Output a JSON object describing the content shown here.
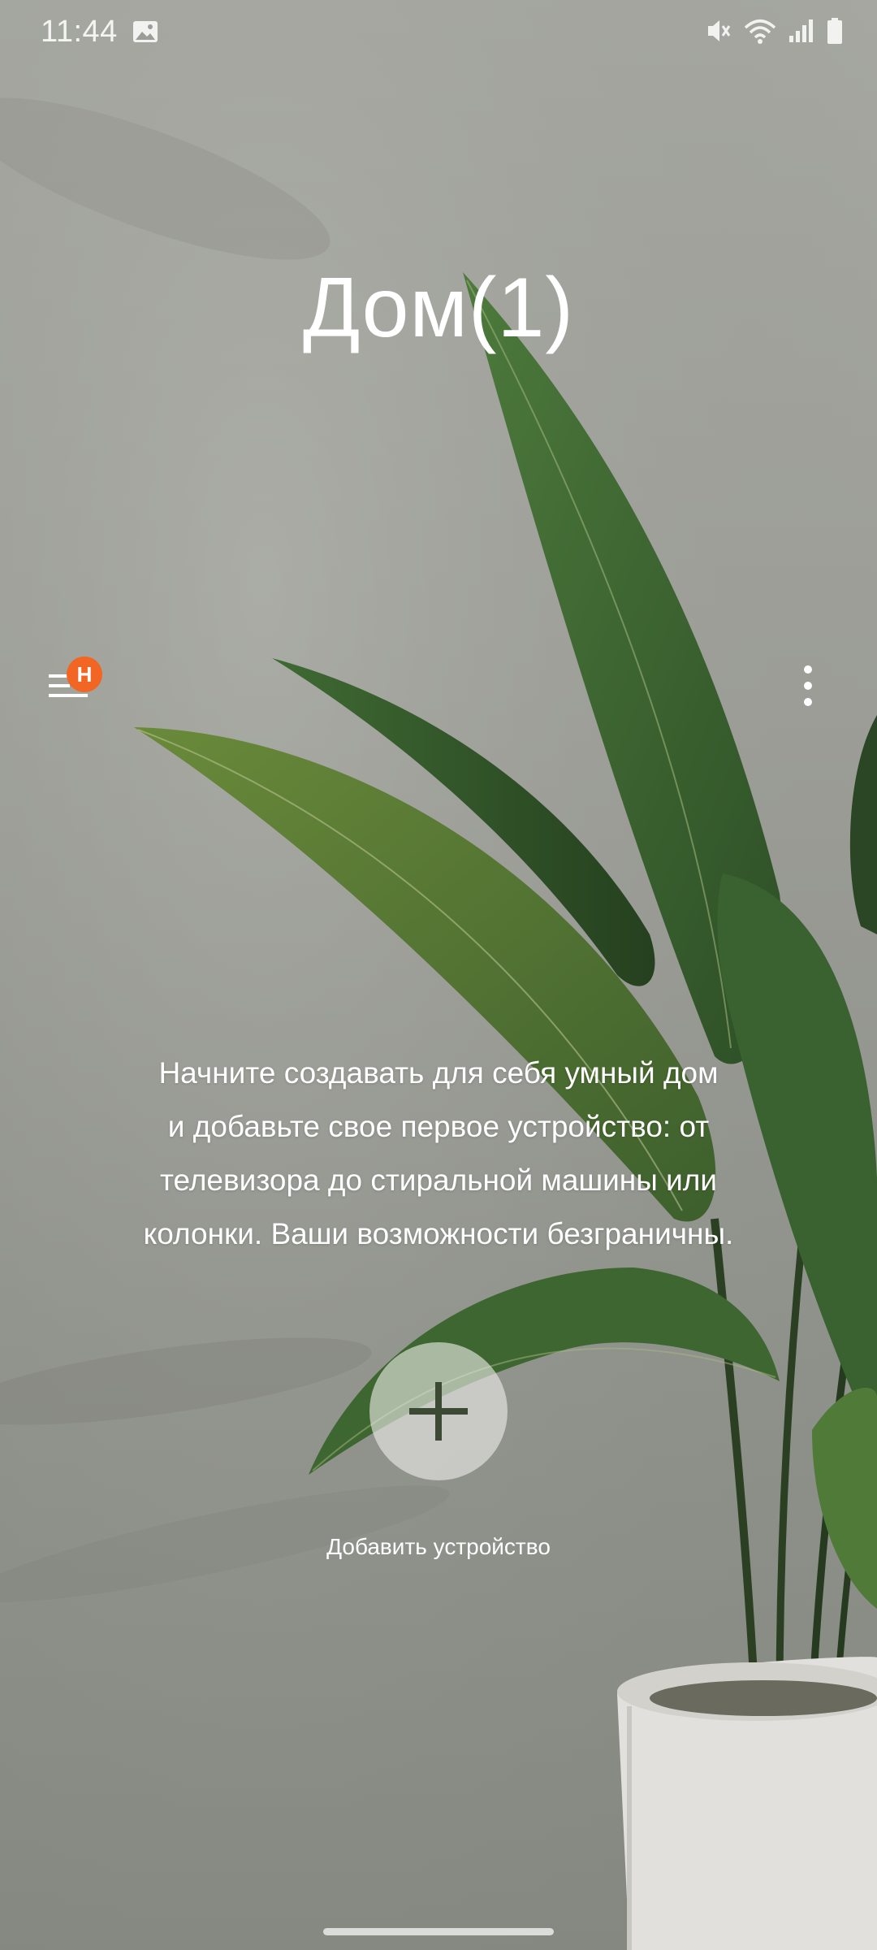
{
  "status_bar": {
    "time": "11:44",
    "icons": [
      "gallery-icon",
      "mute-vibrate-icon",
      "wifi-icon",
      "cellular-signal-icon",
      "battery-icon"
    ]
  },
  "home": {
    "title": "Дом(1)"
  },
  "toolbar": {
    "menu_icon": "hamburger-menu-icon",
    "menu_badge": "H",
    "more_icon": "more-vert-icon"
  },
  "onboarding": {
    "lines": [
      "Начните создавать для себя умный дом",
      "и добавьте свое первое устройство: от",
      "телевизора до стиральной машины или",
      "колонки. Ваши возможности безграничны."
    ]
  },
  "add_device": {
    "icon": "plus-icon",
    "label": "Добавить устройство"
  },
  "colors": {
    "badge": "#f26522",
    "plus": "#3d4a33",
    "text": "#ffffff"
  }
}
